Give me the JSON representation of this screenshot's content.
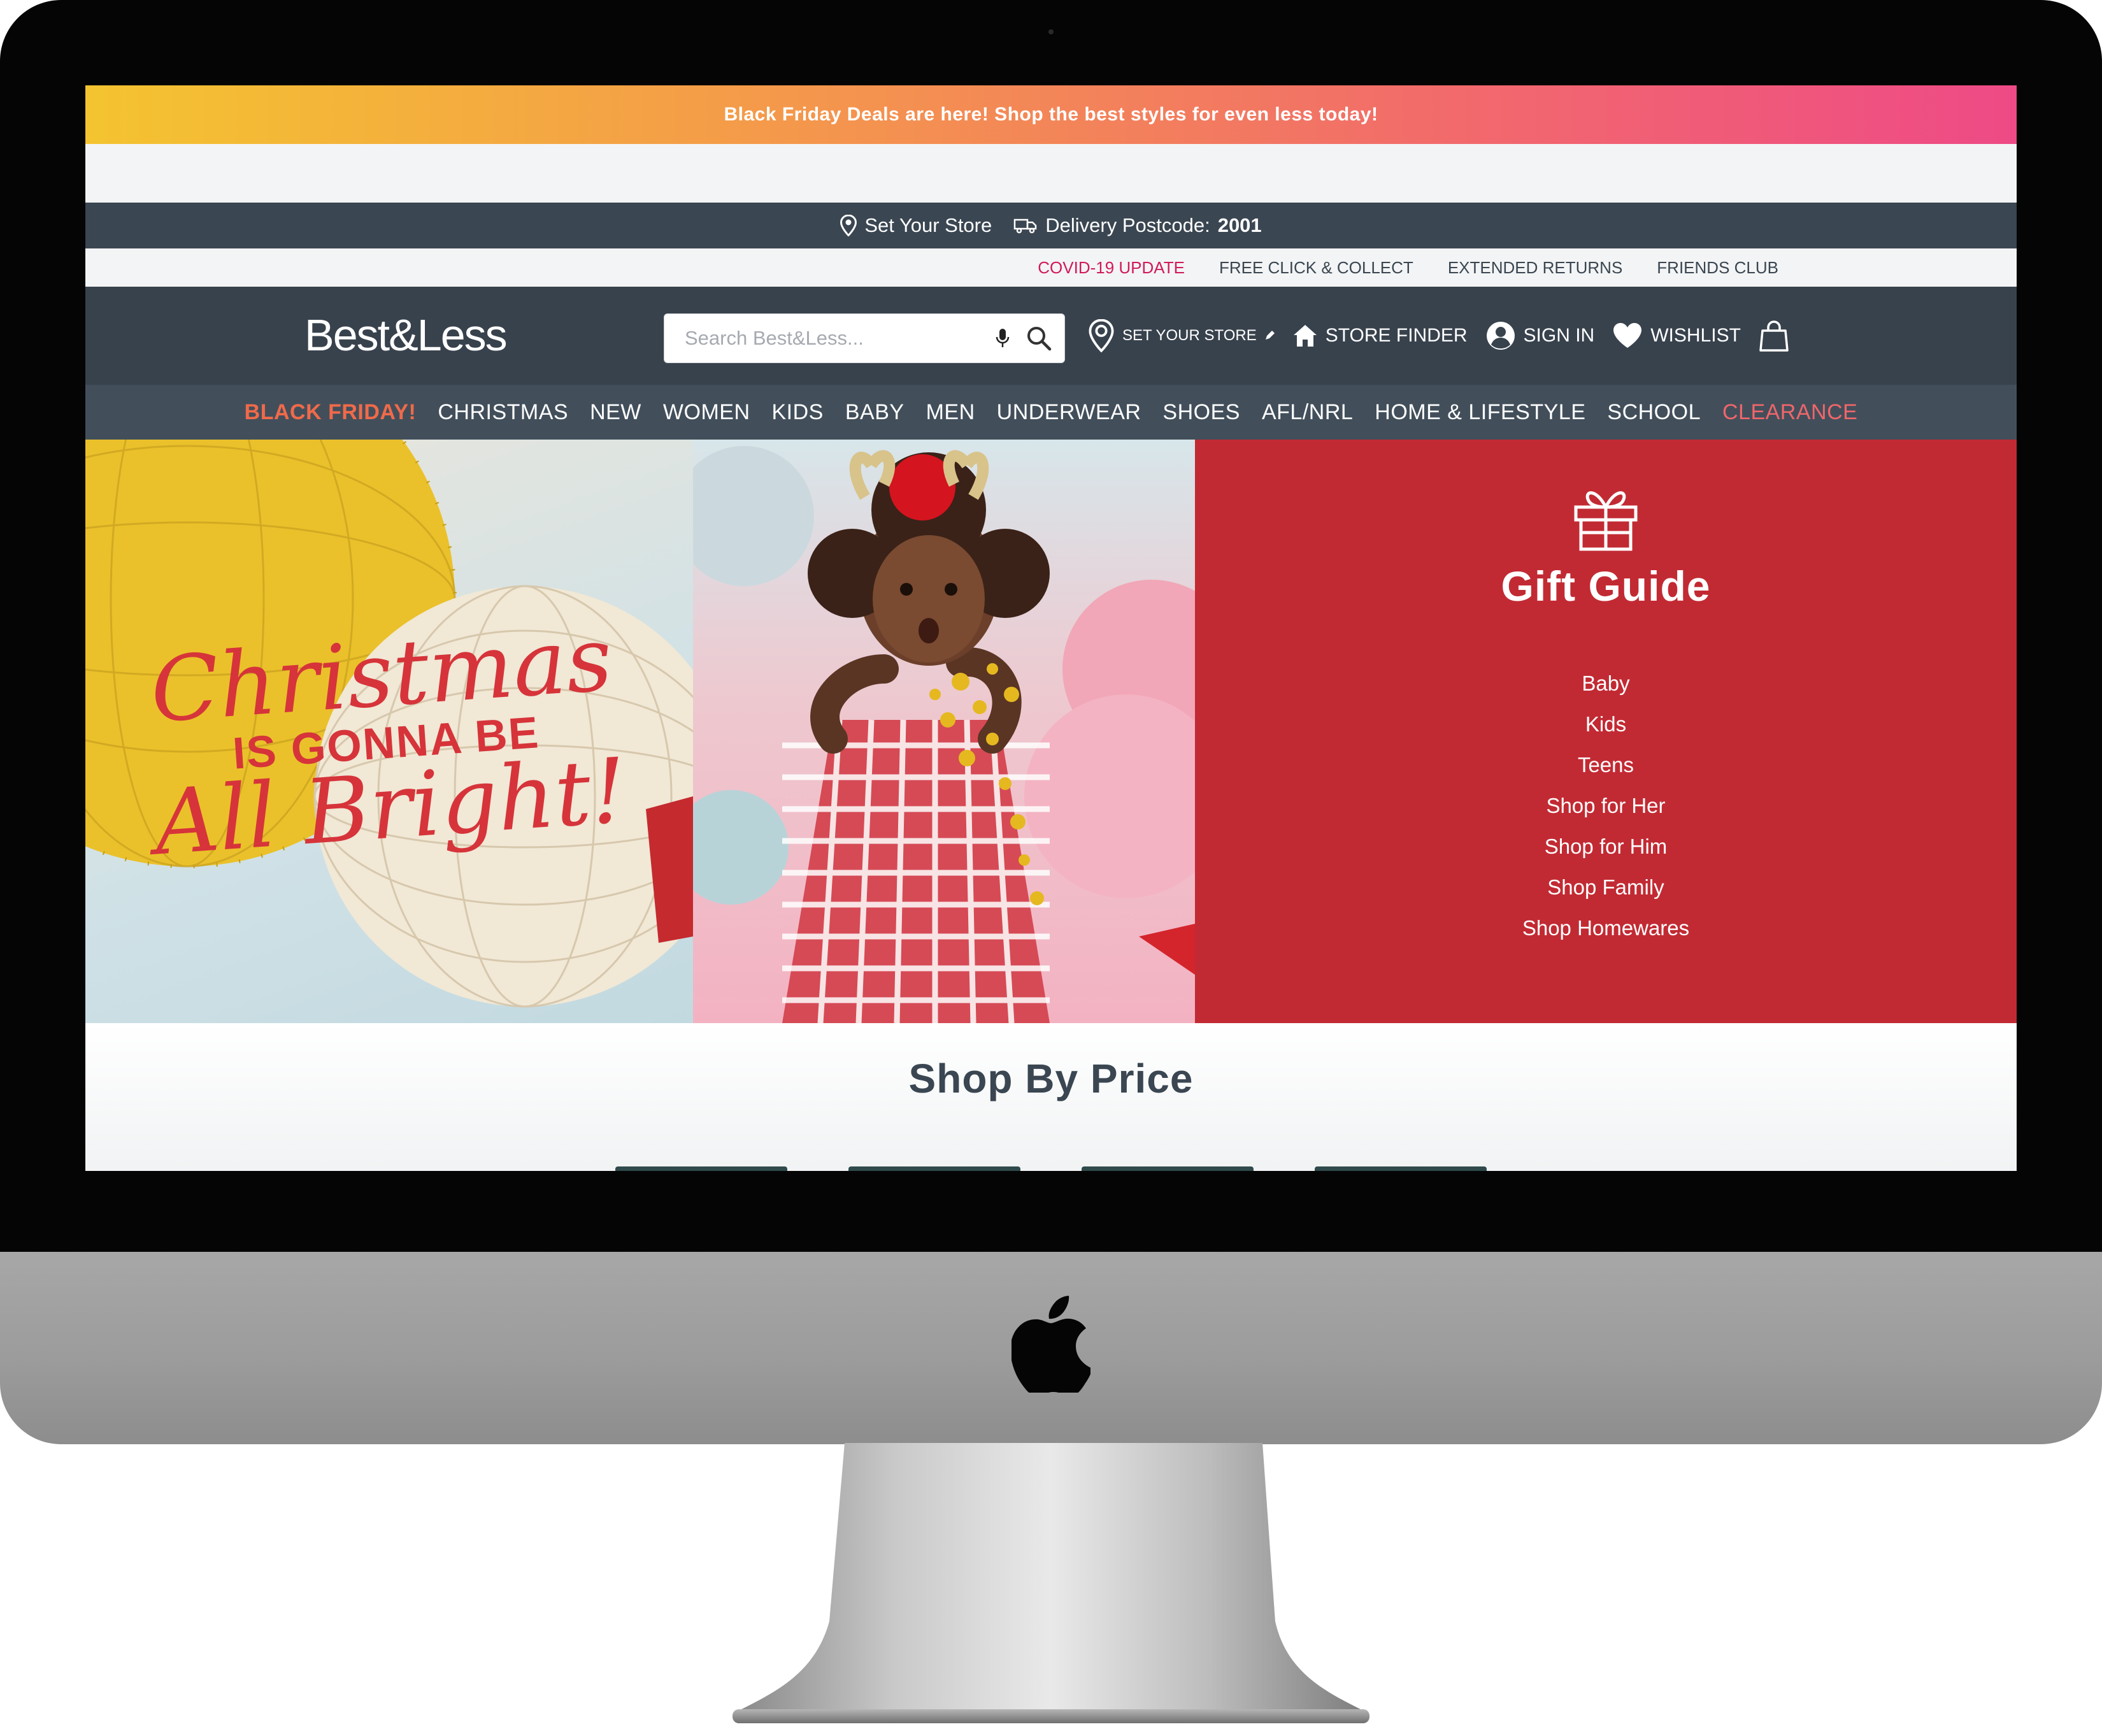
{
  "promo": {
    "text": "Black Friday Deals are here! Shop the best styles for even less today!"
  },
  "storebar": {
    "set_store": "Set Your Store",
    "delivery_label": "Delivery Postcode:",
    "postcode": "2001"
  },
  "utility": {
    "links": [
      "COVID-19 UPDATE",
      "FREE CLICK & COLLECT",
      "EXTENDED RETURNS",
      "FRIENDS CLUB"
    ]
  },
  "header": {
    "brand": "Best&Less",
    "search_placeholder": "Search Best&Less...",
    "set_store": "SET YOUR STORE",
    "store_finder": "STORE FINDER",
    "sign_in": "SIGN IN",
    "wishlist": "WISHLIST"
  },
  "nav": {
    "items": [
      "BLACK FRIDAY!",
      "CHRISTMAS",
      "NEW",
      "WOMEN",
      "KIDS",
      "BABY",
      "MEN",
      "UNDERWEAR",
      "SHOES",
      "AFL/NRL",
      "HOME & LIFESTYLE",
      "SCHOOL",
      "CLEARANCE"
    ]
  },
  "hero": {
    "headline_line1": "Christmas",
    "headline_line2": "IS GONNA BE",
    "headline_line3": "All Bright!",
    "gift_title": "Gift Guide",
    "gift_links": [
      "Baby",
      "Kids",
      "Teens",
      "Shop for Her",
      "Shop for Him",
      "Shop Family",
      "Shop Homewares"
    ]
  },
  "shop_by_price": {
    "title": "Shop By Price"
  },
  "colors": {
    "promo_start": "#f4c430",
    "promo_end": "#ee4a86",
    "header": "#38424d",
    "nav": "#424f5b",
    "hot": "#f06a4a",
    "gift_bg": "#c22a33"
  }
}
